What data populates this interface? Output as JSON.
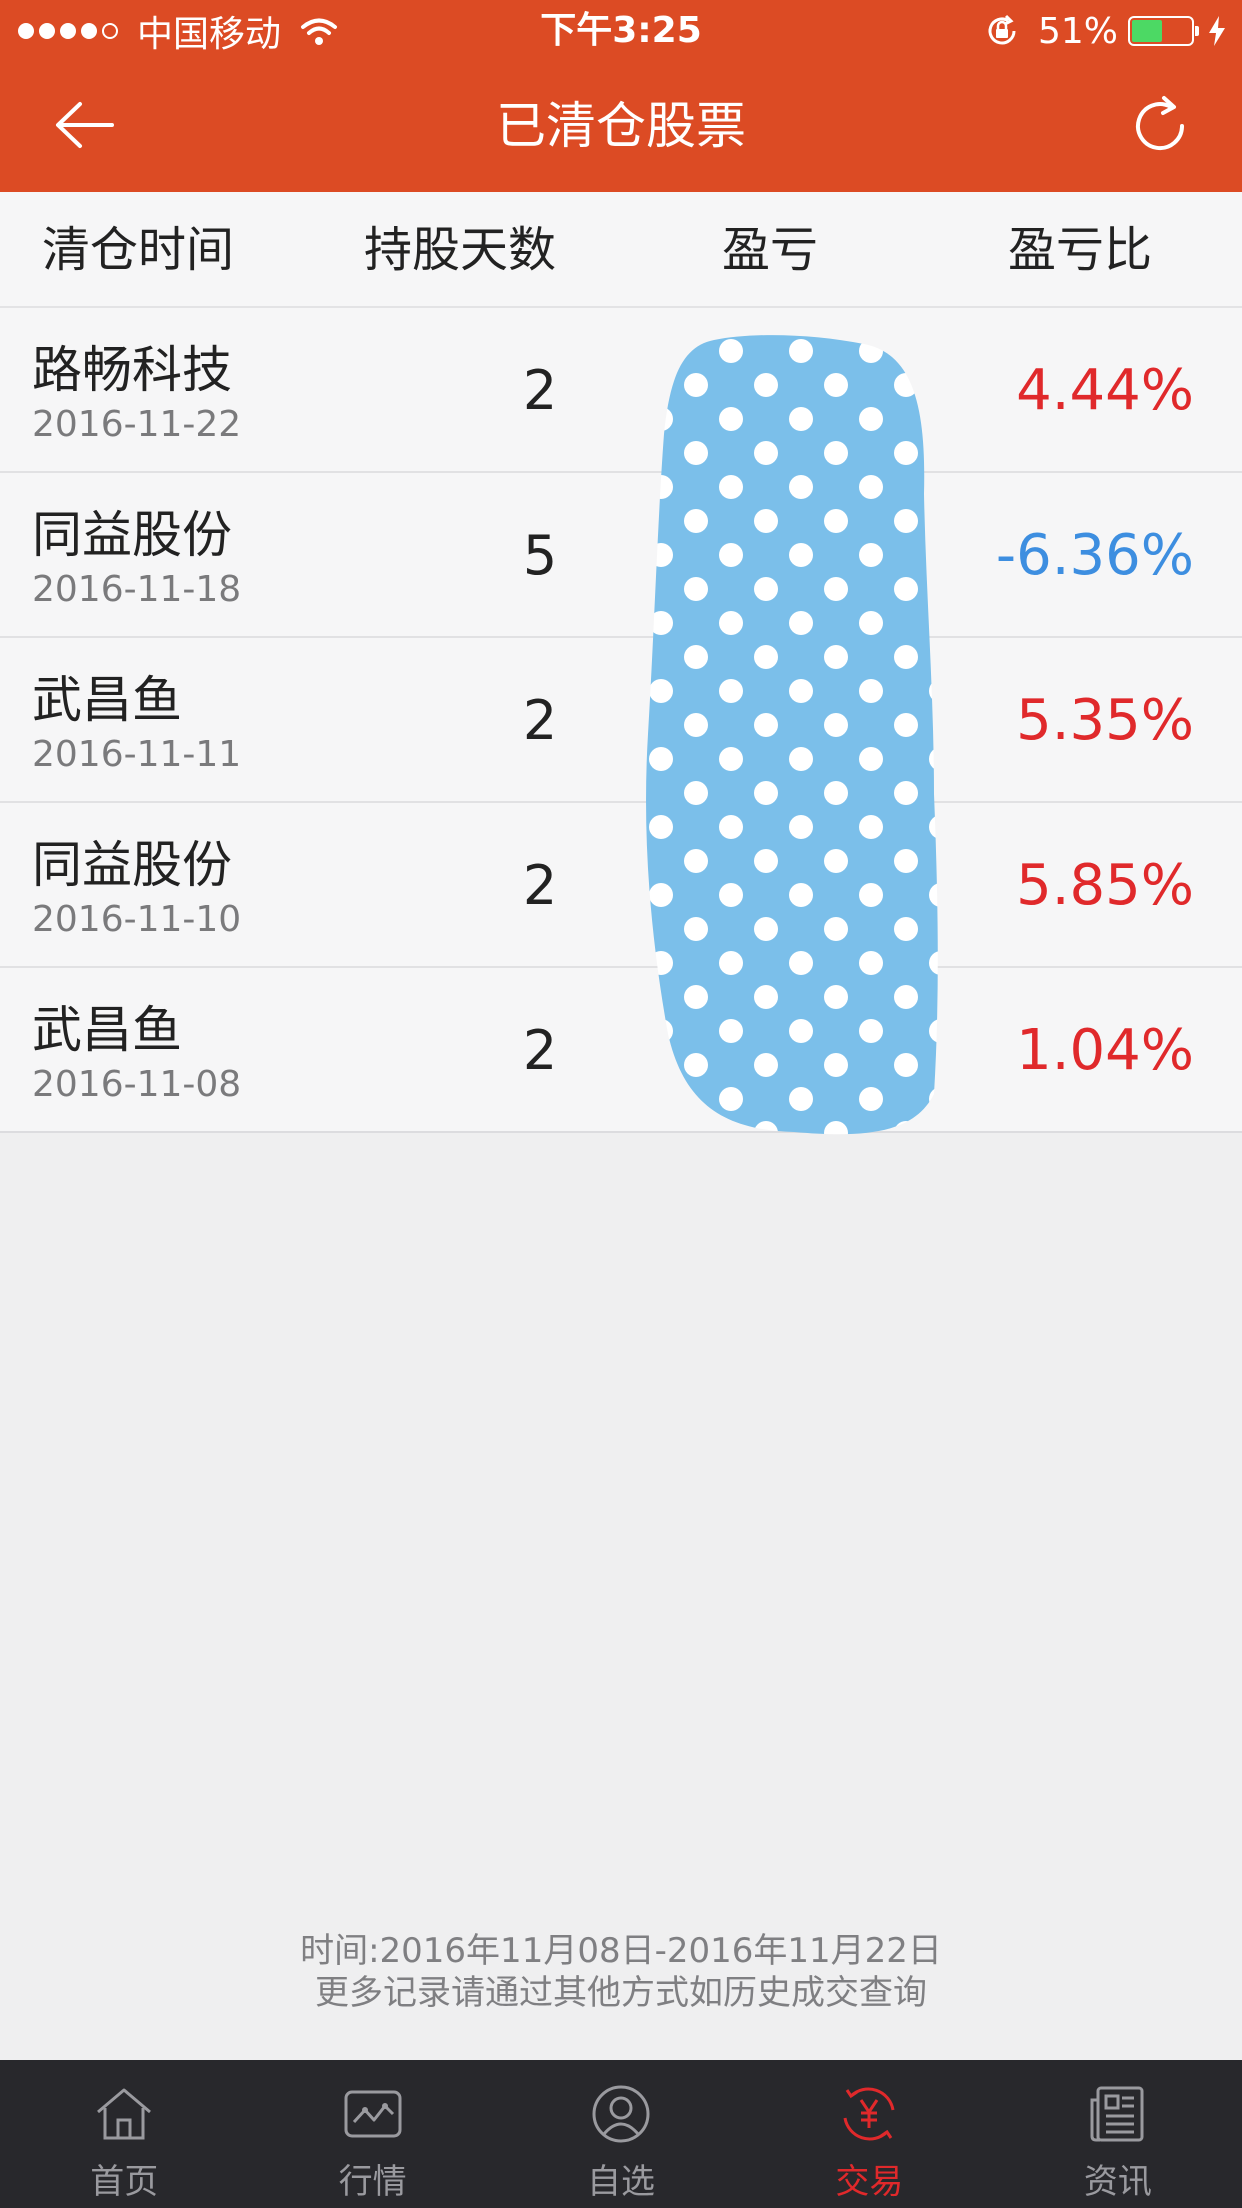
{
  "status_bar": {
    "carrier": "中国移动",
    "time": "下午3:25",
    "battery": "51%",
    "battery_level": 0.51
  },
  "nav": {
    "title": "已清仓股票",
    "back_icon": "back-arrow-icon",
    "refresh_icon": "refresh-icon"
  },
  "table": {
    "headers": [
      "清仓时间",
      "持股天数",
      "盈亏",
      "盈亏比"
    ],
    "rows": [
      {
        "name": "路畅科技",
        "date": "2016-11-22",
        "days": "2",
        "ratio": "4.44%",
        "trend": "up"
      },
      {
        "name": "同益股份",
        "date": "2016-11-18",
        "days": "5",
        "ratio": "-6.36%",
        "trend": "down"
      },
      {
        "name": "武昌鱼",
        "date": "2016-11-11",
        "days": "2",
        "ratio": "5.35%",
        "trend": "up"
      },
      {
        "name": "同益股份",
        "date": "2016-11-10",
        "days": "2",
        "ratio": "5.85%",
        "trend": "up"
      },
      {
        "name": "武昌鱼",
        "date": "2016-11-08",
        "days": "2",
        "ratio": "1.04%",
        "trend": "up"
      }
    ]
  },
  "colors": {
    "brand": "#dc4b24",
    "gain": "#e0292b",
    "loss": "#3d8ee0",
    "redaction": "#7bbfea"
  },
  "footer": {
    "line1": "时间:2016年11月08日-2016年11月22日",
    "line2": "更多记录请通过其他方式如历史成交查询"
  },
  "tabbar": {
    "tabs": [
      {
        "label": "首页",
        "icon": "home-icon"
      },
      {
        "label": "行情",
        "icon": "chart-icon"
      },
      {
        "label": "自选",
        "icon": "user-circle-icon"
      },
      {
        "label": "交易",
        "icon": "yuan-icon",
        "active": true
      },
      {
        "label": "资讯",
        "icon": "news-icon"
      }
    ]
  }
}
